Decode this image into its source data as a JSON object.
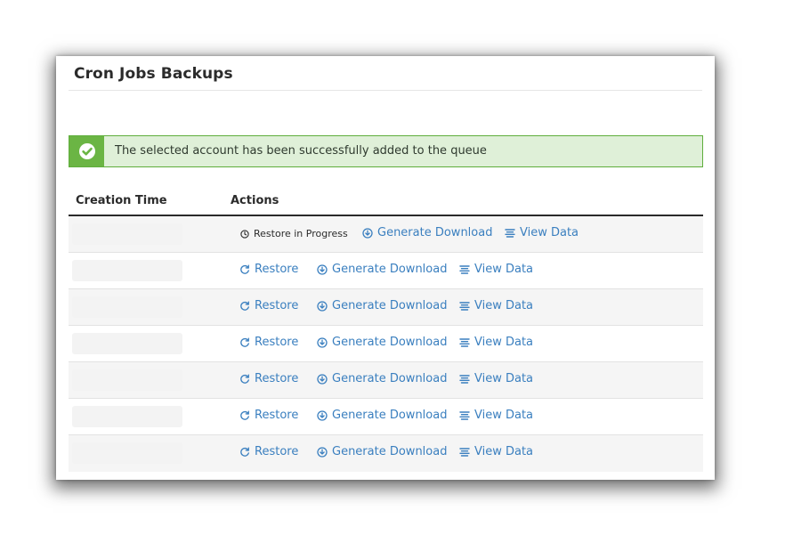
{
  "page": {
    "title": "Cron Jobs Backups"
  },
  "alert": {
    "icon": "check-circle-icon",
    "message": "The selected account has been successfully added to the queue",
    "bg_color": "#dff0d8",
    "accent_color": "#6bb544"
  },
  "table": {
    "columns": [
      "Creation Time",
      "Actions"
    ],
    "rows": [
      {
        "date": "",
        "status": "Restore in Progress",
        "restore_label": "",
        "generate_label": "Generate Download",
        "view_label": "View Data"
      },
      {
        "date": "",
        "status": "",
        "restore_label": "Restore",
        "generate_label": "Generate Download",
        "view_label": "View Data"
      },
      {
        "date": "",
        "status": "",
        "restore_label": "Restore",
        "generate_label": "Generate Download",
        "view_label": "View Data"
      },
      {
        "date": "",
        "status": "",
        "restore_label": "Restore",
        "generate_label": "Generate Download",
        "view_label": "View Data"
      },
      {
        "date": "",
        "status": "",
        "restore_label": "Restore",
        "generate_label": "Generate Download",
        "view_label": "View Data"
      },
      {
        "date": "",
        "status": "",
        "restore_label": "Restore",
        "generate_label": "Generate Download",
        "view_label": "View Data"
      },
      {
        "date": "",
        "status": "",
        "restore_label": "Restore",
        "generate_label": "Generate Download",
        "view_label": "View Data"
      }
    ]
  },
  "icons": {
    "restore": "refresh-icon",
    "generate": "download-circle-icon",
    "view": "list-icon",
    "progress": "clock-icon"
  },
  "colors": {
    "link": "#3a7fbf",
    "text": "#2b2b2b"
  }
}
